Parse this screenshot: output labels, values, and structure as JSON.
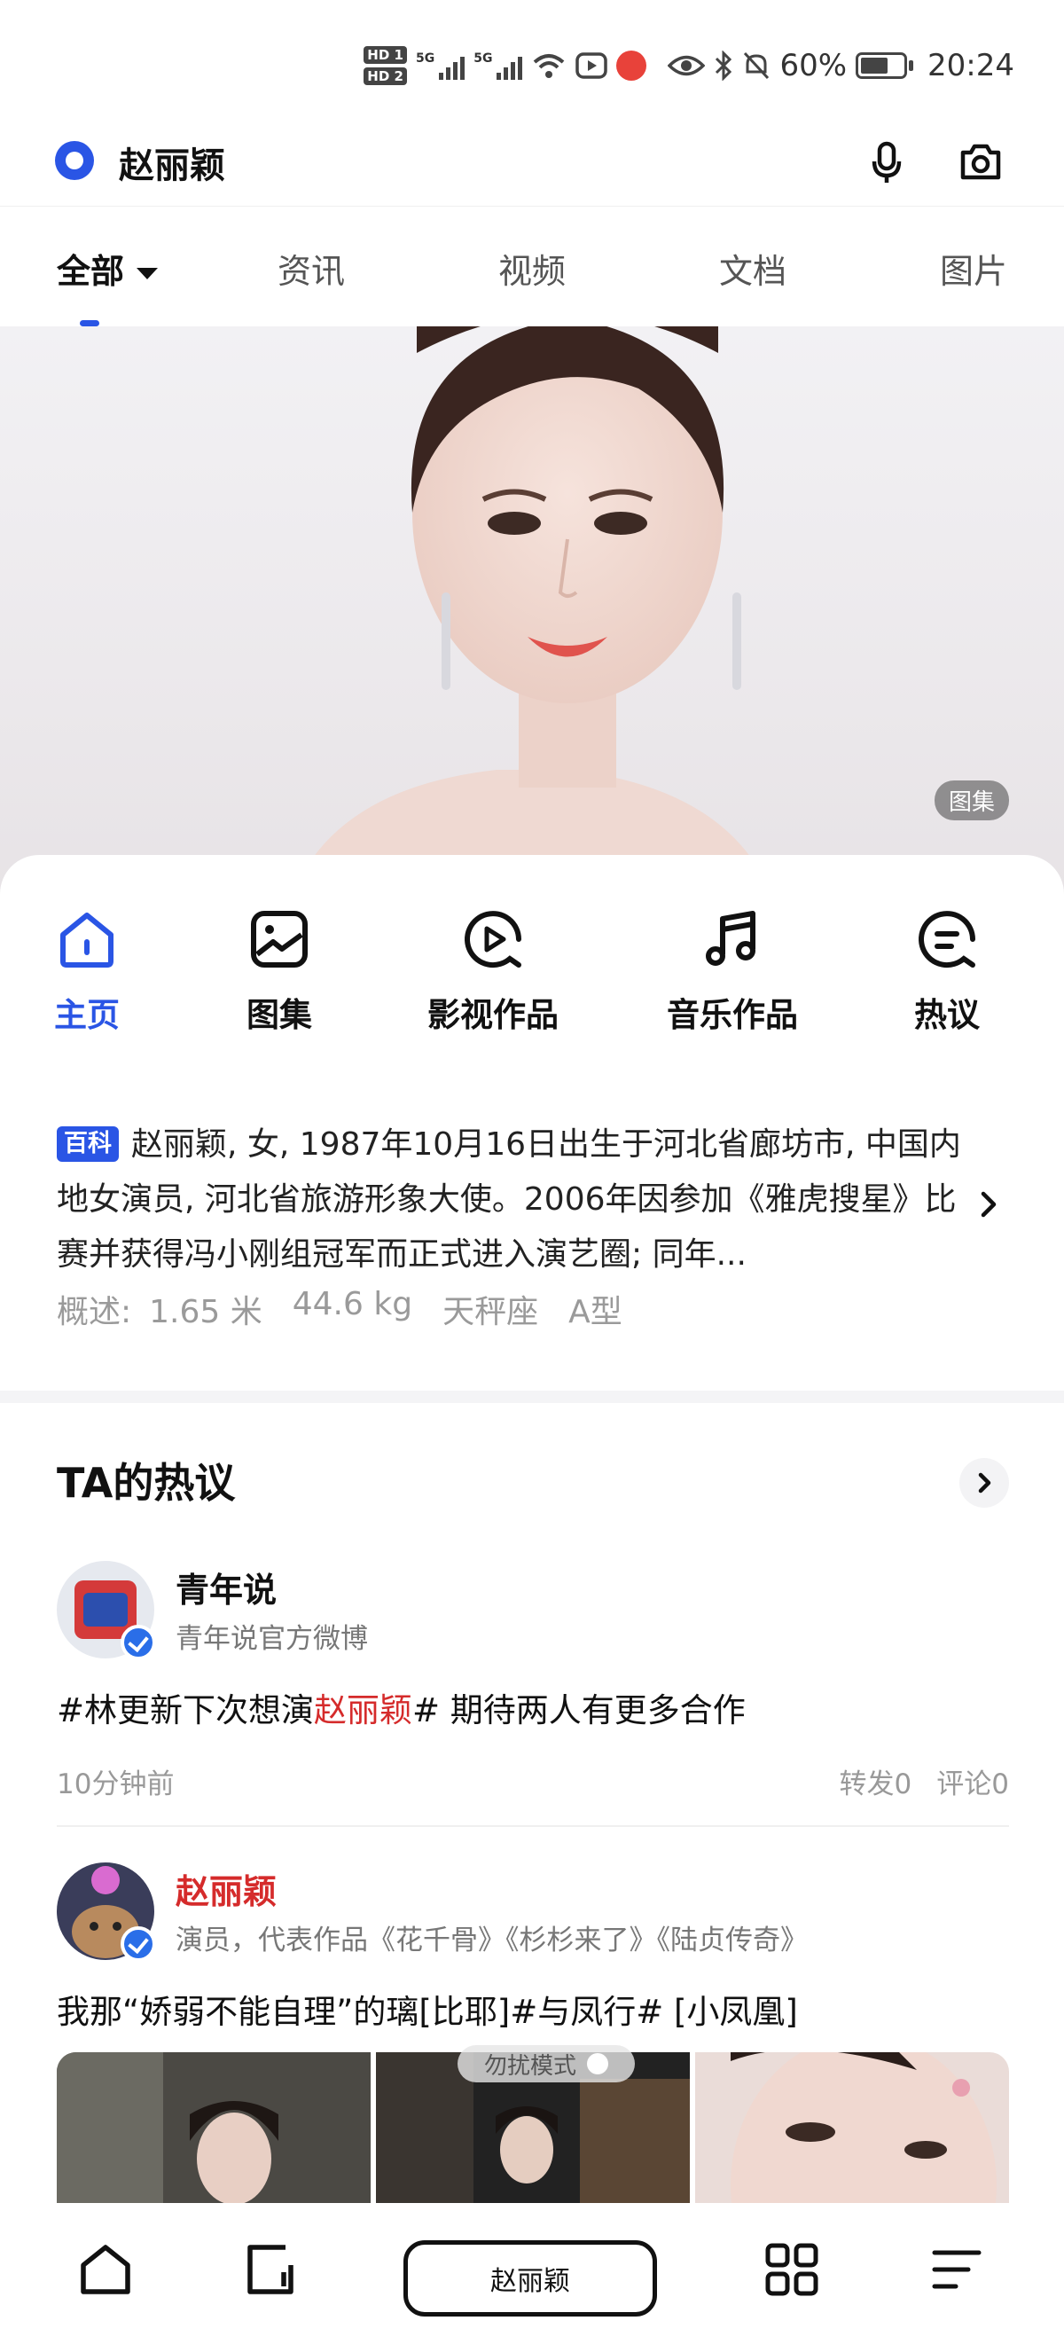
{
  "status_bar": {
    "hd1": "HD 1",
    "hd2": "HD 2",
    "sig_label": "5G",
    "battery": "60%",
    "time": "20:24"
  },
  "search": {
    "query": "赵丽颖"
  },
  "tabs": [
    {
      "label": "全部"
    },
    {
      "label": "资讯"
    },
    {
      "label": "视频"
    },
    {
      "label": "文档"
    },
    {
      "label": "图片"
    }
  ],
  "hero": {
    "badge": "图集"
  },
  "nav": [
    {
      "label": "主页",
      "icon": "home-icon"
    },
    {
      "label": "图集",
      "icon": "gallery-icon"
    },
    {
      "label": "影视作品",
      "icon": "play-icon"
    },
    {
      "label": "音乐作品",
      "icon": "music-icon"
    },
    {
      "label": "热议",
      "icon": "chat-icon"
    }
  ],
  "intro": {
    "tag": "百科",
    "text": "赵丽颖, 女, 1987年10月16日出生于河北省廊坊市, 中国内地女演员, 河北省旅游形象大使。2006年因参加《雅虎搜星》比赛并获得冯小刚组冠军而正式进入演艺圈; 同年...",
    "meta_label": "概述:",
    "height": "1.65 米",
    "weight": "44.6 kg",
    "zodiac": "天秤座",
    "blood": "A型"
  },
  "hot": {
    "title": "TA的热议",
    "posts": [
      {
        "author": "青年说",
        "sub": "青年说官方微博",
        "text_before": "#林更新下次想演",
        "text_hl": "赵丽颖",
        "text_after": "# 期待两人有更多合作",
        "time": "10分钟前",
        "reposts": "转发0",
        "comments": "评论0"
      },
      {
        "author": "赵丽颖",
        "sub": "演员，代表作品《花千骨》《杉杉来了》《陆贞传奇》",
        "text": "我那“娇弱不能自理”的璃[比耶]#与凤行# [小凤凰]"
      }
    ]
  },
  "toast": "勿扰模式",
  "bottom_bar": {
    "search_label": "赵丽颖"
  },
  "colors": {
    "accent": "#2a55e5",
    "highlight": "#d52b2b"
  }
}
